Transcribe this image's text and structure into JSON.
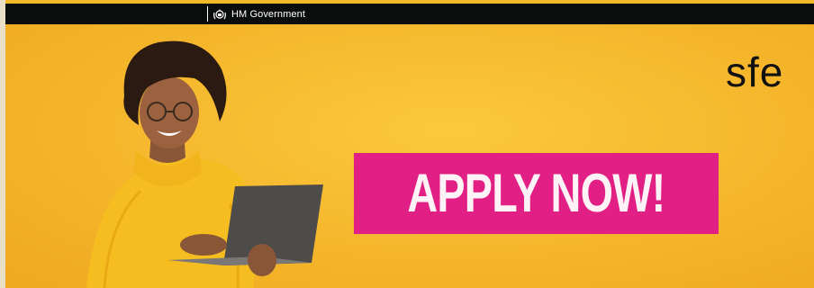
{
  "gov_bar": {
    "label": "HM Government",
    "crest_icon": "royal-crest-icon"
  },
  "hero": {
    "brand": "sfe",
    "cta": "APPLY NOW!",
    "image": "woman-with-laptop-photo"
  },
  "colors": {
    "background": "#f3b829",
    "gov_bar": "#0b0c0c",
    "cta_background": "#e21f85",
    "cta_text": "#fdf2f6"
  }
}
